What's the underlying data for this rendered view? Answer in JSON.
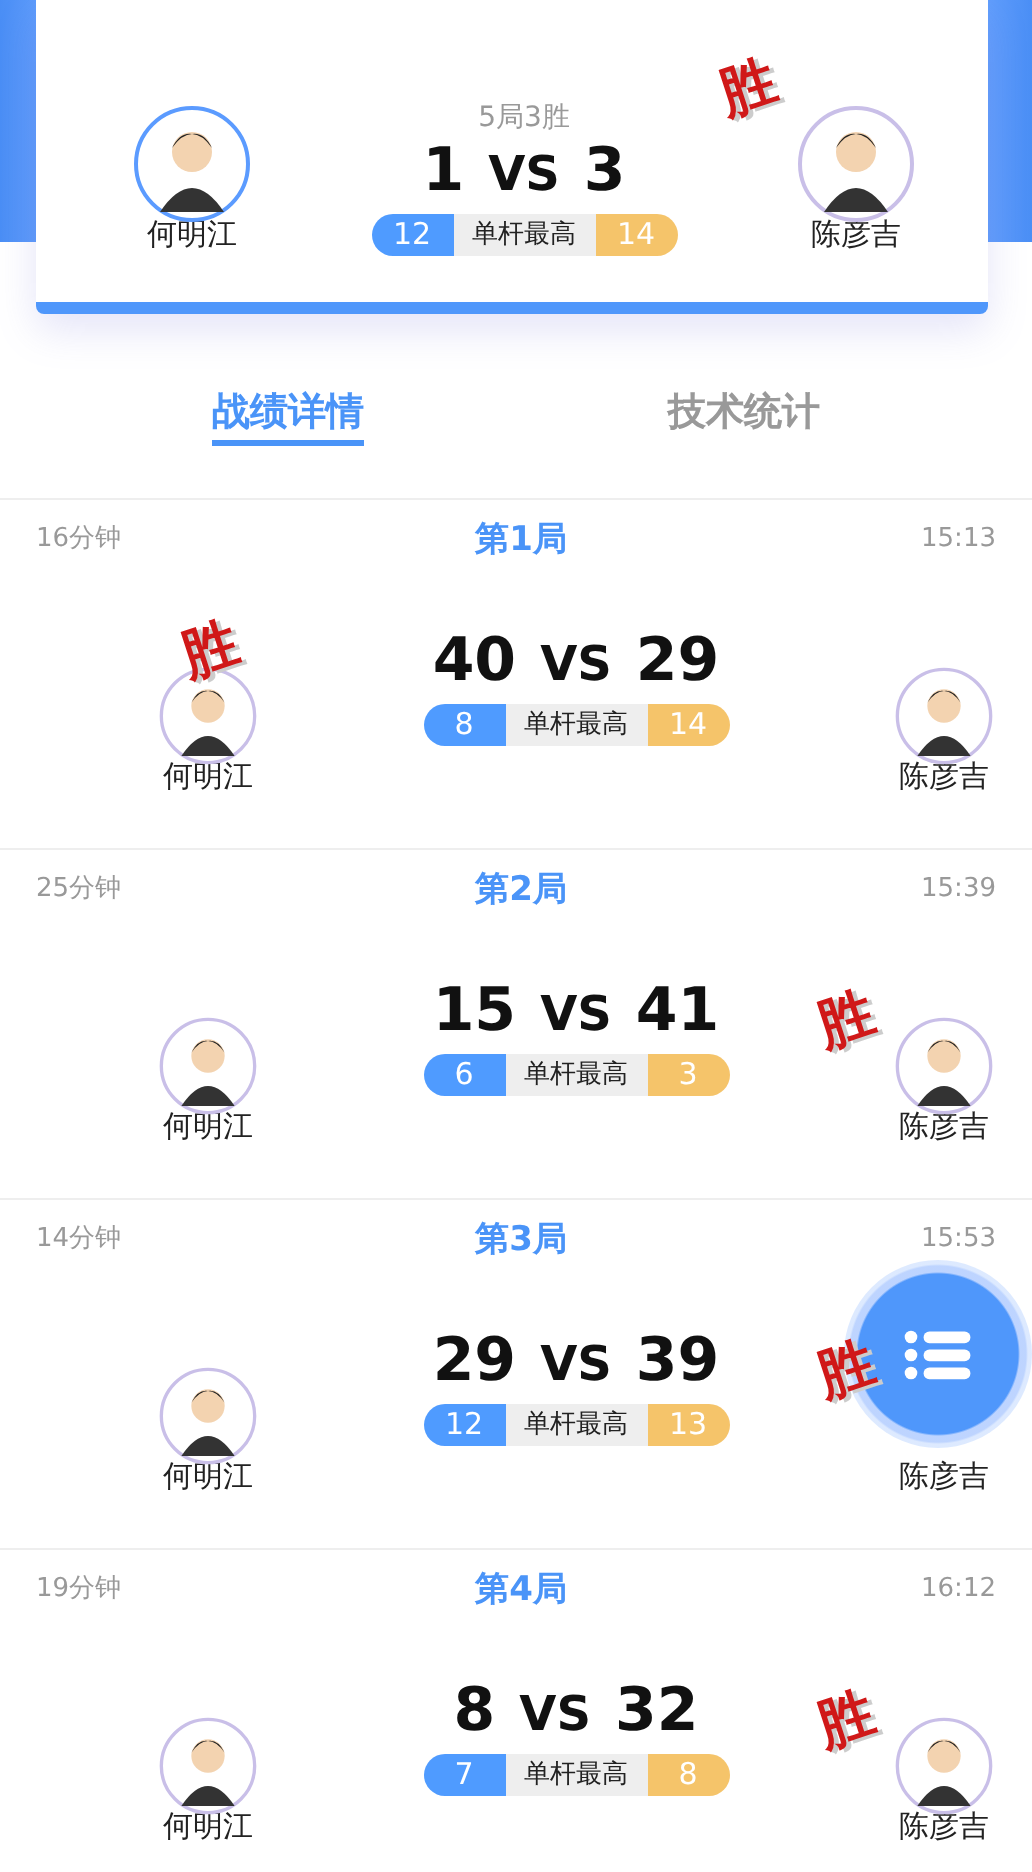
{
  "match": {
    "format": "5局3胜",
    "vs": "VS",
    "best_label": "单杆最高",
    "win_mark": "胜",
    "left": {
      "name": "何明江",
      "score": "1",
      "best": "12",
      "won": false
    },
    "right": {
      "name": "陈彦吉",
      "score": "3",
      "best": "14",
      "won": true
    }
  },
  "tabs": [
    {
      "label": "战绩详情",
      "selected": true
    },
    {
      "label": "技术统计",
      "selected": false
    }
  ],
  "games": [
    {
      "duration": "16分钟",
      "title": "第1局",
      "time": "15:13",
      "vs": "VS",
      "best_label": "单杆最高",
      "win_mark": "胜",
      "left": {
        "name": "何明江",
        "score": "40",
        "best": "8",
        "won": true
      },
      "right": {
        "name": "陈彦吉",
        "score": "29",
        "best": "14",
        "won": false
      }
    },
    {
      "duration": "25分钟",
      "title": "第2局",
      "time": "15:39",
      "vs": "VS",
      "best_label": "单杆最高",
      "win_mark": "胜",
      "left": {
        "name": "何明江",
        "score": "15",
        "best": "6",
        "won": false
      },
      "right": {
        "name": "陈彦吉",
        "score": "41",
        "best": "3",
        "won": true
      }
    },
    {
      "duration": "14分钟",
      "title": "第3局",
      "time": "15:53",
      "vs": "VS",
      "best_label": "单杆最高",
      "win_mark": "胜",
      "left": {
        "name": "何明江",
        "score": "29",
        "best": "12",
        "won": false
      },
      "right": {
        "name": "陈彦吉",
        "score": "39",
        "best": "13",
        "won": true
      }
    },
    {
      "duration": "19分钟",
      "title": "第4局",
      "time": "16:12",
      "vs": "VS",
      "best_label": "单杆最高",
      "win_mark": "胜",
      "left": {
        "name": "何明江",
        "score": "8",
        "best": "7",
        "won": false
      },
      "right": {
        "name": "陈彦吉",
        "score": "32",
        "best": "8",
        "won": true
      }
    }
  ]
}
